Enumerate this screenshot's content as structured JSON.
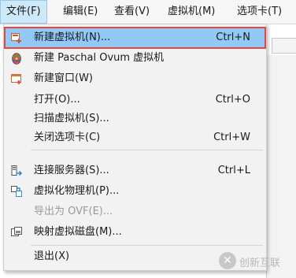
{
  "menubar": {
    "items": [
      "文件(F)",
      "编辑(E)",
      "查看(V)",
      "虚拟机(M)",
      "选项卡(T)"
    ]
  },
  "file_menu": {
    "items": [
      {
        "label": "新建虚拟机(N)...",
        "shortcut": "Ctrl+N",
        "icon": "new-vm-icon",
        "state": "highlighted"
      },
      {
        "label": "新建 Paschal Ovum 虚拟机",
        "shortcut": "",
        "icon": "paschal-ovum-egg-icon",
        "state": "normal"
      },
      {
        "label": "新建窗口(W)",
        "shortcut": "",
        "icon": "new-window-icon",
        "state": "normal"
      },
      {
        "label": "打开(O)...",
        "shortcut": "Ctrl+O",
        "icon": "",
        "state": "normal"
      },
      {
        "label": "扫描虚拟机(S)...",
        "shortcut": "",
        "icon": "",
        "state": "normal"
      },
      {
        "label": "关闭选项卡(C)",
        "shortcut": "Ctrl+W",
        "icon": "",
        "state": "normal"
      },
      {
        "label": "连接服务器(S)...",
        "shortcut": "Ctrl+L",
        "icon": "connect-server-icon",
        "state": "normal"
      },
      {
        "label": "虚拟化物理机(P)...",
        "shortcut": "",
        "icon": "virtualize-physical-icon",
        "state": "normal"
      },
      {
        "label": "导出为 OVF(E)...",
        "shortcut": "",
        "icon": "",
        "state": "disabled"
      },
      {
        "label": "映射虚拟磁盘(M)...",
        "shortcut": "",
        "icon": "map-disk-icon",
        "state": "normal"
      },
      {
        "label": "退出(X)",
        "shortcut": "",
        "icon": "",
        "state": "normal"
      }
    ]
  },
  "watermark": {
    "text": "创新互联",
    "mark": "✕"
  },
  "colors": {
    "highlight": "#91c9f7",
    "highlight_outline": "#e2483b",
    "menu_bg": "#f2f2f2"
  }
}
